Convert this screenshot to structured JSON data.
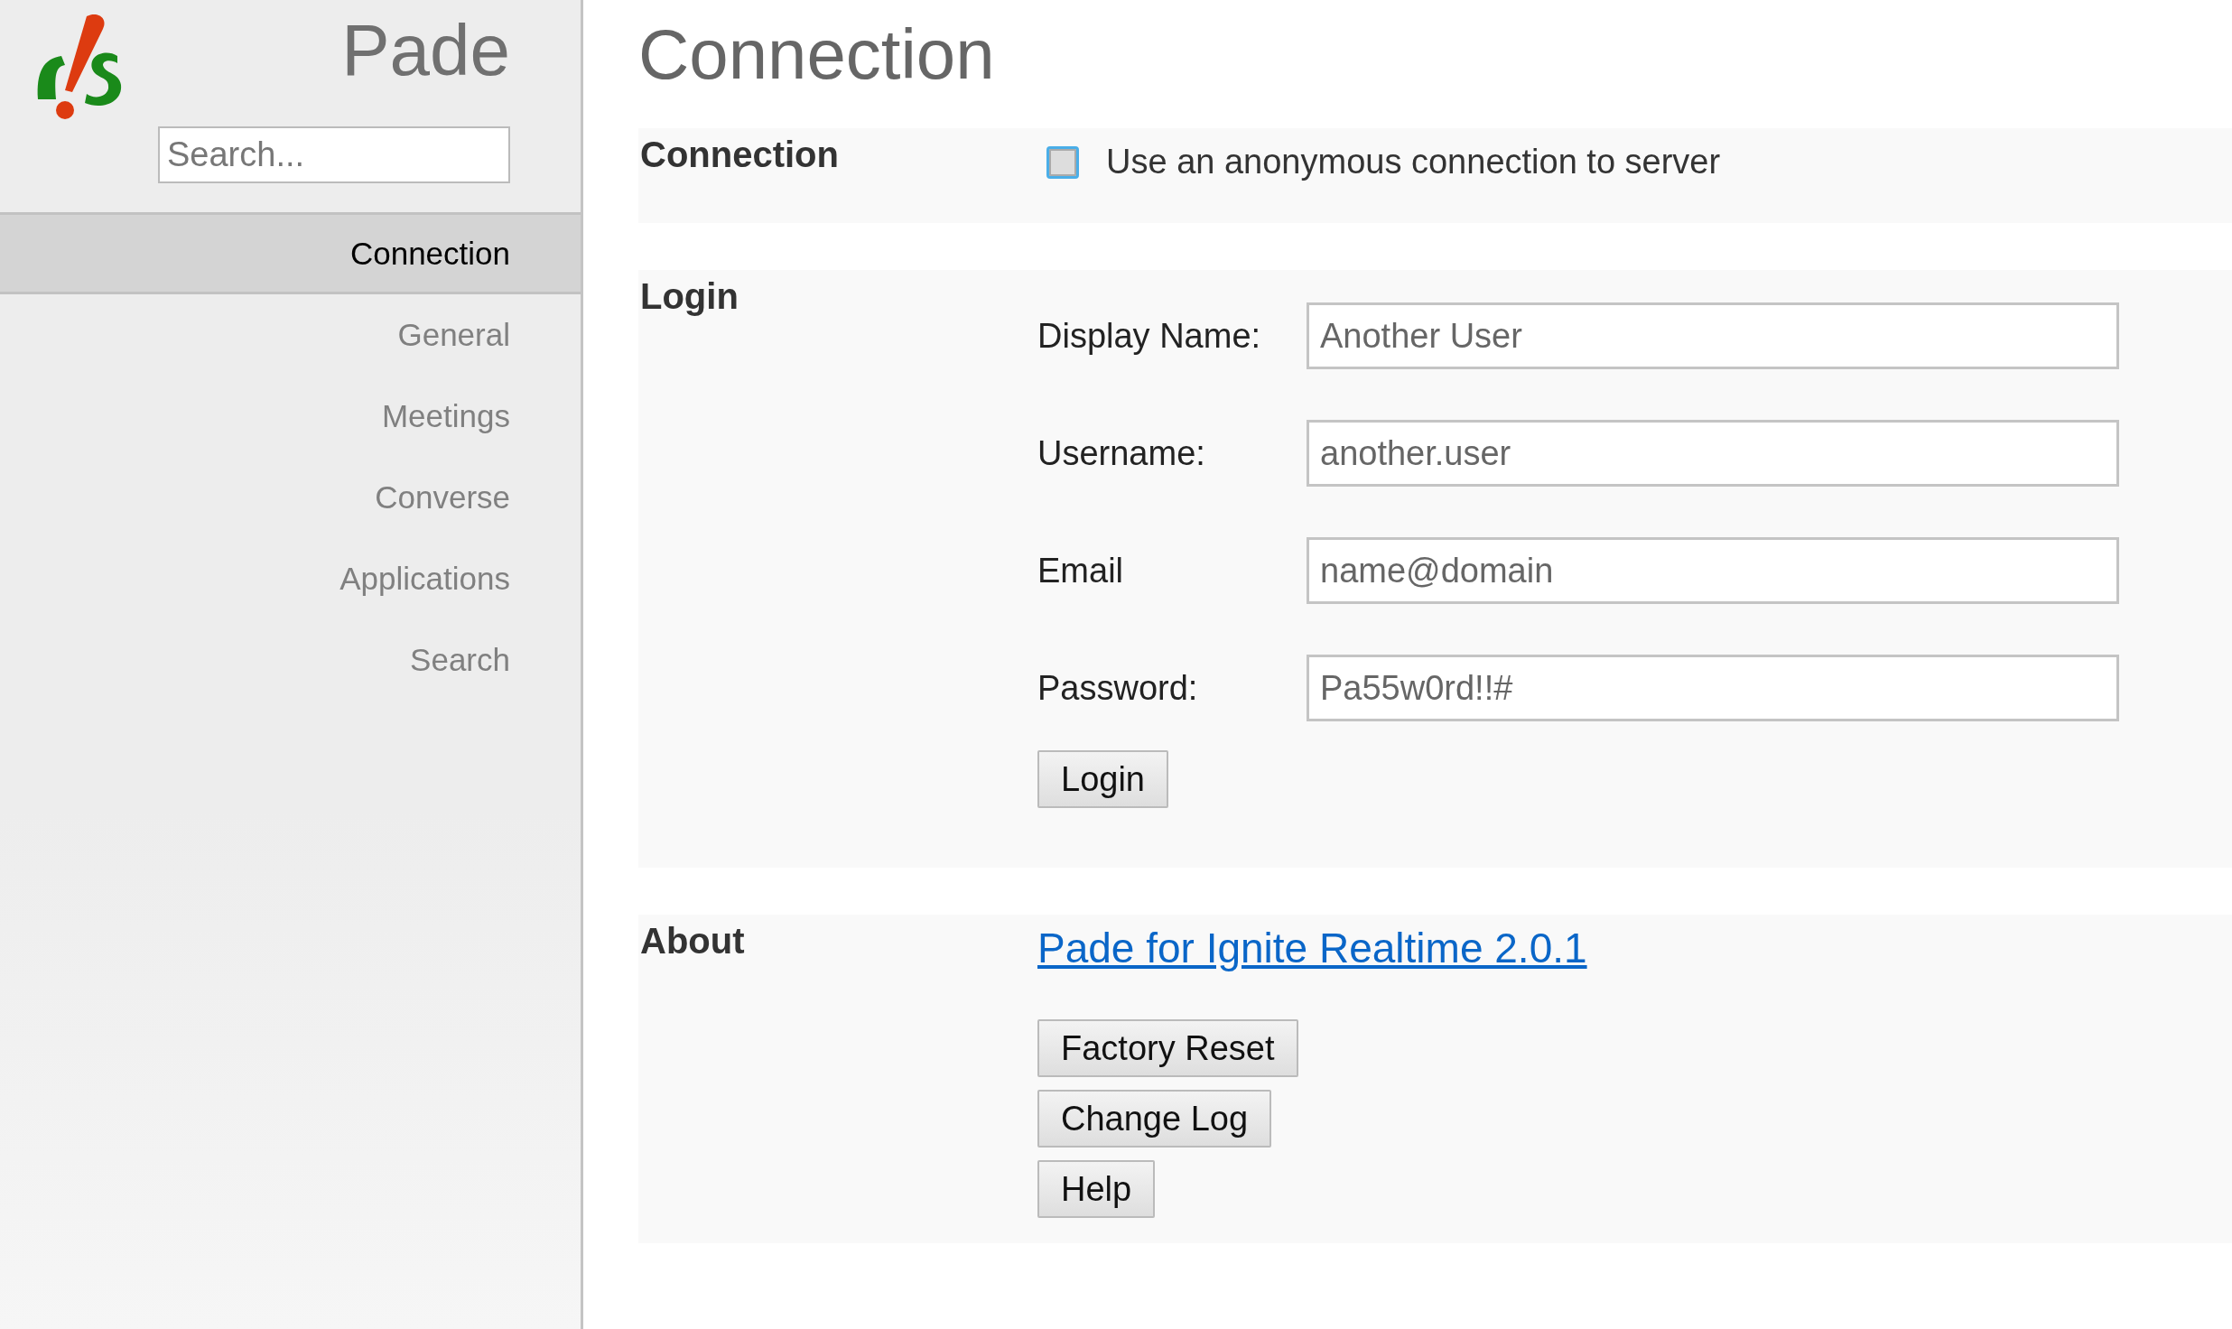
{
  "sidebar": {
    "title": "Pade",
    "search": {
      "placeholder": "Search..."
    },
    "items": [
      {
        "label": "Connection",
        "selected": true
      },
      {
        "label": "General",
        "selected": false
      },
      {
        "label": "Meetings",
        "selected": false
      },
      {
        "label": "Converse",
        "selected": false
      },
      {
        "label": "Applications",
        "selected": false
      },
      {
        "label": "Search",
        "selected": false
      }
    ]
  },
  "page_title": "Connection",
  "sections": [
    {
      "kind": "connection",
      "title": "Connection",
      "checkbox": {
        "label": "Use an anonymous connection to server",
        "checked": false
      }
    },
    {
      "kind": "login",
      "title": "Login",
      "fields": [
        {
          "label": "Display Name:",
          "value": "Another User"
        },
        {
          "label": "Username:",
          "value": "another.user"
        },
        {
          "label": "Email",
          "value": "name@domain"
        },
        {
          "label": "Password:",
          "value": "Pa55w0rd!!#"
        }
      ],
      "button": "Login"
    },
    {
      "kind": "about",
      "title": "About",
      "link": "Pade for Ignite Realtime 2.0.1",
      "buttons": [
        "Factory Reset",
        "Change Log",
        "Help"
      ]
    }
  ]
}
